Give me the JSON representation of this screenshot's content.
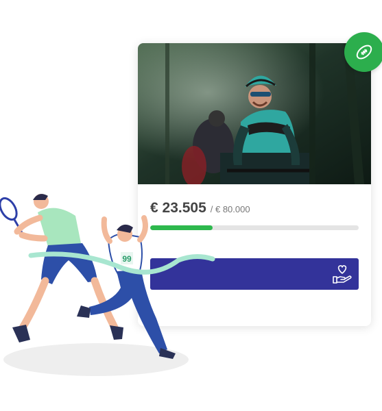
{
  "campaign": {
    "raised": "€ 23.505",
    "goal": "/ € 80.000",
    "progress_fraction": 0.3,
    "progress_color": "#2db84d"
  },
  "donate_button": {
    "label": "",
    "icon": "donate-heart-hand-icon",
    "color": "#33339a"
  },
  "badge": {
    "icon": "football-icon",
    "color": "#2cae4d"
  },
  "photo": {
    "subject": "cyclist-photo"
  },
  "illustration": {
    "bib_number": "99"
  }
}
